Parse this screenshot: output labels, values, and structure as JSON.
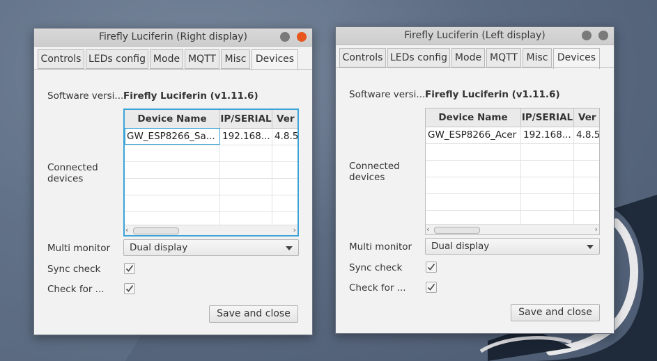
{
  "colors": {
    "accent": "#3ba3d6",
    "close_button": "#e8571e",
    "desktop": "#5d6c83"
  },
  "windows": [
    {
      "title": "Firefly Luciferin (Right display)",
      "tabs": [
        "Controls",
        "LEDs config",
        "Mode",
        "MQTT",
        "Misc",
        "Devices"
      ],
      "active_tab": "Devices",
      "software_version_label": "Software versi...",
      "software_version_value": "Firefly Luciferin (v1.11.6)",
      "connected_devices_label": "Connected devices",
      "table": {
        "columns": [
          "Device Name",
          "IP/SERIAL",
          "Ver"
        ],
        "rows": [
          [
            "GW_ESP8266_Sa...",
            "192.168...",
            "4.8.5"
          ]
        ]
      },
      "multi_monitor_label": "Multi monitor",
      "multi_monitor_value": "Dual display",
      "sync_check_label": "Sync check",
      "sync_check_checked": true,
      "check_for_label": "Check for ...",
      "check_for_checked": true,
      "save_button": "Save and close"
    },
    {
      "title": "Firefly Luciferin (Left display)",
      "tabs": [
        "Controls",
        "LEDs config",
        "Mode",
        "MQTT",
        "Misc",
        "Devices"
      ],
      "active_tab": "Devices",
      "software_version_label": "Software versi...",
      "software_version_value": "Firefly Luciferin (v1.11.6)",
      "connected_devices_label": "Connected devices",
      "table": {
        "columns": [
          "Device Name",
          "IP/SERIAL",
          "Ver"
        ],
        "rows": [
          [
            "GW_ESP8266_Acer",
            "192.168...",
            "4.8.5"
          ]
        ]
      },
      "multi_monitor_label": "Multi monitor",
      "multi_monitor_value": "Dual display",
      "sync_check_label": "Sync check",
      "sync_check_checked": true,
      "check_for_label": "Check for ...",
      "check_for_checked": true,
      "save_button": "Save and close"
    }
  ]
}
